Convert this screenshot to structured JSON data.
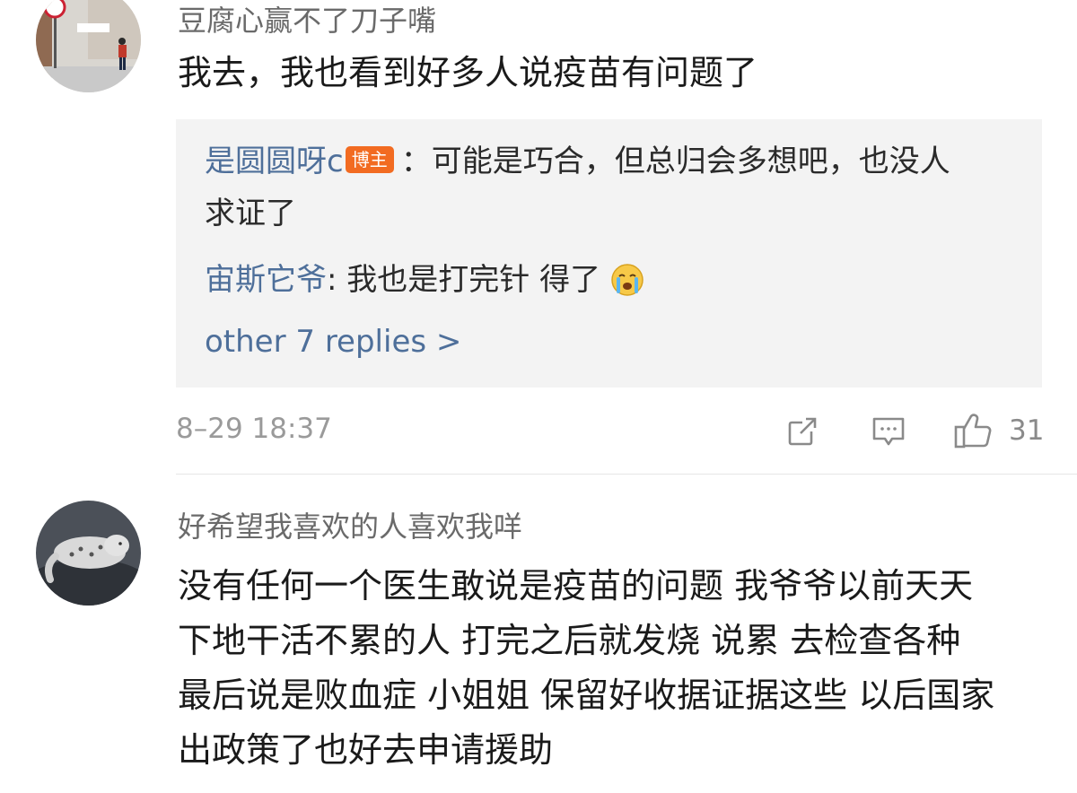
{
  "comment1": {
    "username": "豆腐心赢不了刀子嘴",
    "text": "我去，我也看到好多人说疫苗有问题了",
    "replies": {
      "reply1": {
        "author": "是圆圆呀c",
        "badge": "博主",
        "text_line1": "：可能是巧合，但总归会多想吧，也没人",
        "text_line2": "求证了"
      },
      "reply2": {
        "author": "宙斯它爷",
        "text": ": 我也是打完针 得了",
        "emoji": "crying-face-icon"
      },
      "more_label": "other 7 replies >"
    },
    "timestamp": "8–29 18:37",
    "like_count": "31"
  },
  "comment2": {
    "username": "好希望我喜欢的人喜欢我咩",
    "lines": [
      "没有任何一个医生敢说是疫苗的问题 我爷爷以前天天",
      "下地干活不累的人 打完之后就发烧 说累 去检查各种",
      "最后说是败血症 小姐姐 保留好收据证据这些 以后国家",
      "出政策了也好去申请援助"
    ]
  },
  "colors": {
    "link": "#4e6f9a",
    "badge": "#f26b21",
    "reply_bg": "#f3f3f3"
  }
}
